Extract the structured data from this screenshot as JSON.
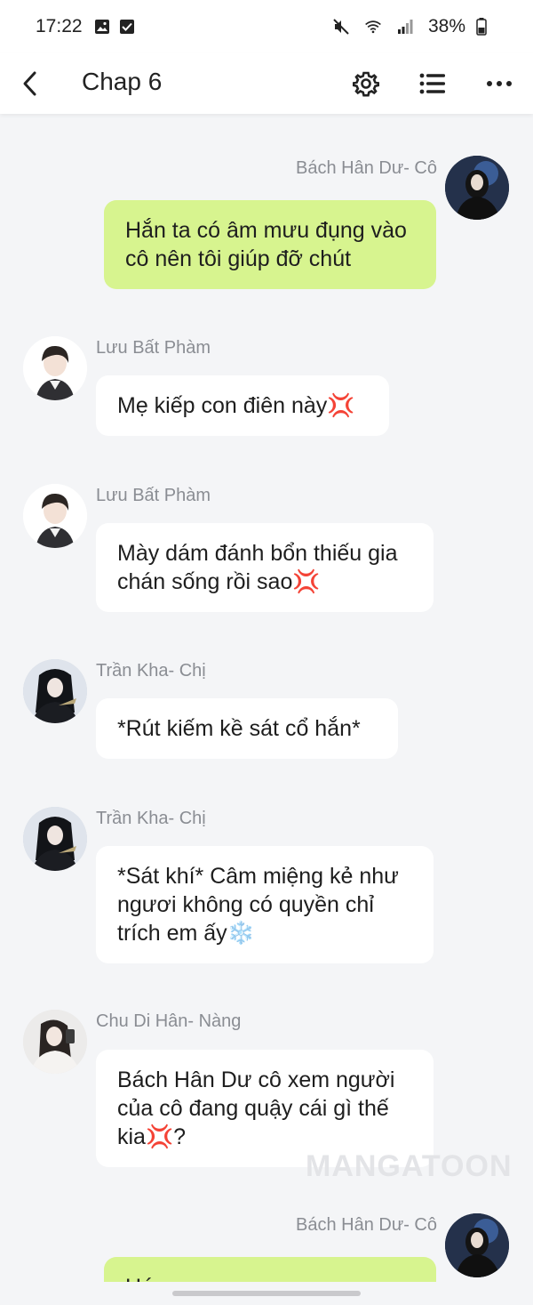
{
  "status_bar": {
    "time": "17:22",
    "battery": "38%",
    "icons": [
      "image-icon",
      "checkbox-icon",
      "mute-icon",
      "wifi-icon",
      "signal-icon",
      "battery-icon"
    ]
  },
  "header": {
    "title": "Chap 6",
    "icons": [
      "back-icon",
      "settings-icon",
      "list-icon",
      "more-icon"
    ]
  },
  "messages": [
    {
      "sender": "Bách Hân Dư- Cô",
      "side": "right",
      "text": "Hắn ta có âm mưu đụng vào cô nên tôi giúp đỡ chút"
    },
    {
      "sender": "Lưu Bất Phàm",
      "side": "left",
      "text": "Mẹ kiếp con điên này💢"
    },
    {
      "sender": "Lưu Bất Phàm",
      "side": "left",
      "text": "Mày dám đánh bổn thiếu gia chán sống rồi sao💢"
    },
    {
      "sender": "Trần Kha- Chị",
      "side": "left",
      "text": "*Rút kiếm kề sát cổ hắn*"
    },
    {
      "sender": "Trần Kha- Chị",
      "side": "left",
      "text": "*Sát khí* Câm miệng kẻ như ngươi không có quyền chỉ trích em ấy❄️"
    },
    {
      "sender": "Chu Di Hân- Nàng",
      "side": "left",
      "text": "Bách Hân Dư cô xem người của cô đang quậy cái gì thế kia💢?"
    },
    {
      "sender": "Bách Hân Dư- Cô",
      "side": "right",
      "text": "Hứa ..."
    }
  ],
  "watermark": "MANGATOON",
  "colors": {
    "background": "#f4f5f7",
    "my_bubble": "#d7f48f",
    "other_bubble": "#ffffff",
    "name_text": "#8a8d93"
  }
}
